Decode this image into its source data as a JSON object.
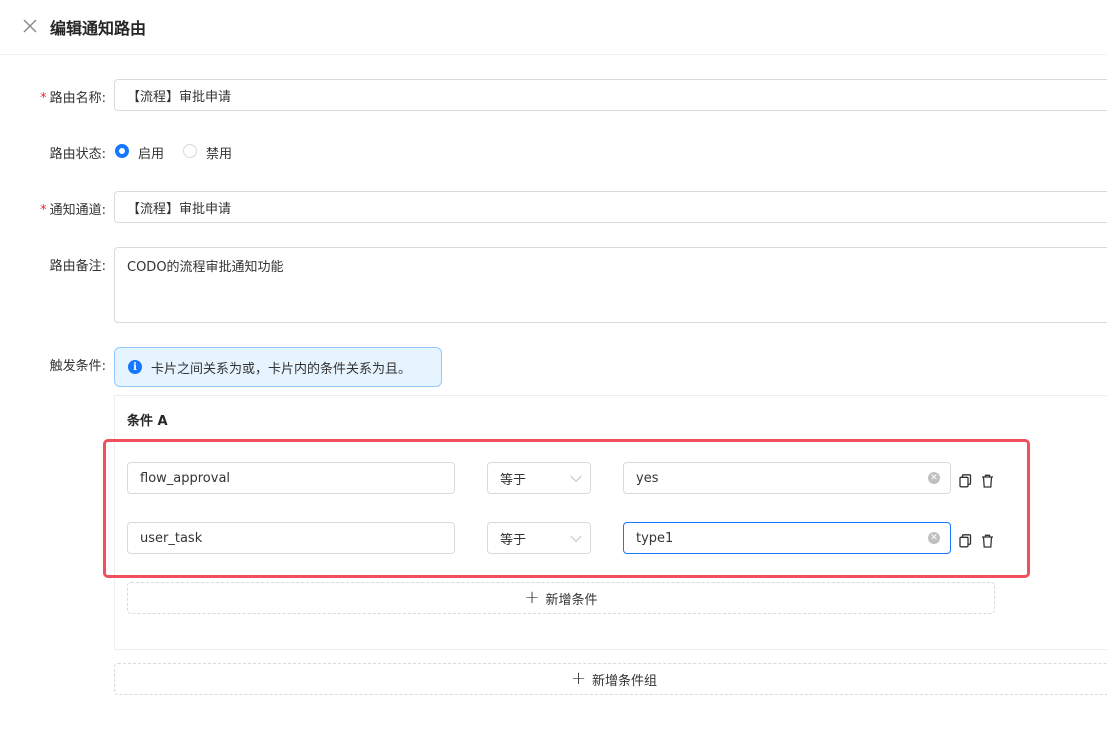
{
  "header": {
    "title": "编辑通知路由",
    "close_icon": "close-icon"
  },
  "form": {
    "route_name": {
      "label": "路由名称:",
      "required": true,
      "value": "【流程】审批申请"
    },
    "route_status": {
      "label": "路由状态:",
      "options": [
        "启用",
        "禁用"
      ],
      "selected": "启用"
    },
    "channel": {
      "label": "通知通道:",
      "required": true,
      "value": "【流程】审批申请"
    },
    "remark": {
      "label": "路由备注:",
      "value": "CODO的流程审批通知功能"
    },
    "trigger": {
      "label": "触发条件:",
      "info": "卡片之间关系为或，卡片内的条件关系为且。",
      "group": {
        "title": "条件 A",
        "conditions": [
          {
            "field": "flow_approval",
            "operator": "等于",
            "value": "yes"
          },
          {
            "field": "user_task",
            "operator": "等于",
            "value": "type1"
          }
        ],
        "add_condition": "新增条件"
      },
      "add_group": "新增条件组"
    }
  },
  "colors": {
    "primary": "#1677ff",
    "required": "#f5222d",
    "highlight": "#f0505e"
  }
}
